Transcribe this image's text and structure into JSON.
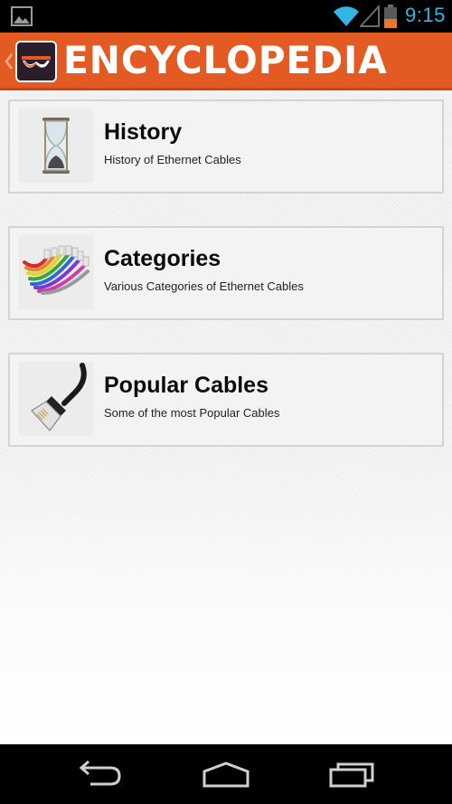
{
  "status_bar": {
    "time": "9:15",
    "icons": [
      "gallery-icon",
      "wifi-icon",
      "signal-icon",
      "battery-icon"
    ],
    "accent_color": "#33b5e5"
  },
  "action_bar": {
    "title": "ENCYCLOPEDIA",
    "background_color": "#e35a22",
    "icons": [
      "up-navigation-icon",
      "app-logo"
    ]
  },
  "items": [
    {
      "title": "History",
      "subtitle": "History of Ethernet Cables",
      "icon": "hourglass-icon"
    },
    {
      "title": "Categories",
      "subtitle": "Various Categories of Ethernet Cables",
      "icon": "colored-cables-icon"
    },
    {
      "title": "Popular Cables",
      "subtitle": "Some of the most Popular Cables",
      "icon": "ethernet-plug-icon"
    }
  ],
  "nav_bar": {
    "buttons": [
      "back-icon",
      "home-icon",
      "recents-icon"
    ]
  }
}
